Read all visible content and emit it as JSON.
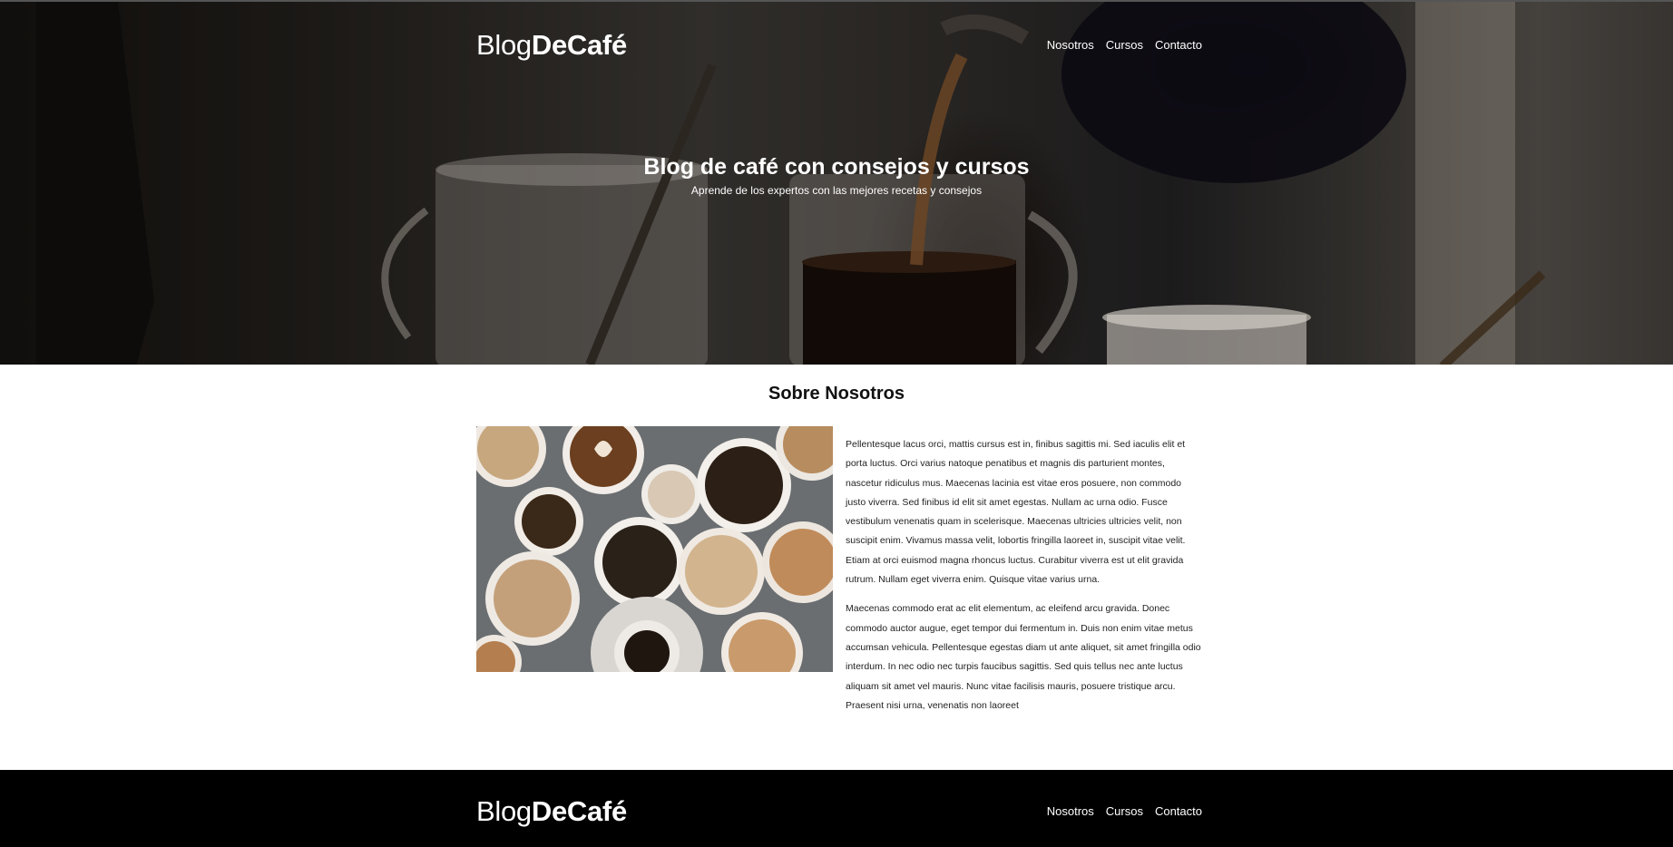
{
  "header": {
    "logo_light": "Blog",
    "logo_bold": "DeCafé",
    "nav": [
      "Nosotros",
      "Cursos",
      "Contacto"
    ]
  },
  "hero": {
    "title": "Blog de café con consejos y cursos",
    "subtitle": "Aprende de los expertos con las mejores recetas y consejos"
  },
  "about": {
    "title": "Sobre Nosotros",
    "paragraphs": [
      "Pellentesque lacus orci, mattis cursus est in, finibus sagittis mi. Sed iaculis elit et porta luctus. Orci varius natoque penatibus et magnis dis parturient montes, nascetur ridiculus mus. Maecenas lacinia est vitae eros posuere, non commodo justo viverra. Sed finibus id elit sit amet egestas. Nullam ac urna odio. Fusce vestibulum venenatis quam in scelerisque. Maecenas ultricies ultricies velit, non suscipit enim. Vivamus massa velit, lobortis fringilla laoreet in, suscipit vitae velit. Etiam at orci euismod magna rhoncus luctus. Curabitur viverra est ut elit gravida rutrum. Nullam eget viverra enim. Quisque vitae varius urna.",
      "Maecenas commodo erat ac elit elementum, ac eleifend arcu gravida. Donec commodo auctor augue, eget tempor dui fermentum in. Duis non enim vitae metus accumsan vehicula. Pellentesque egestas diam ut ante aliquet, sit amet fringilla odio interdum. In nec odio nec turpis faucibus sagittis. Sed quis tellus nec ante luctus aliquam sit amet vel mauris. Nunc vitae facilisis mauris, posuere tristique arcu. Praesent nisi urna, venenatis non laoreet"
    ]
  },
  "footer": {
    "logo_light": "Blog",
    "logo_bold": "DeCafé",
    "nav": [
      "Nosotros",
      "Cursos",
      "Contacto"
    ]
  }
}
